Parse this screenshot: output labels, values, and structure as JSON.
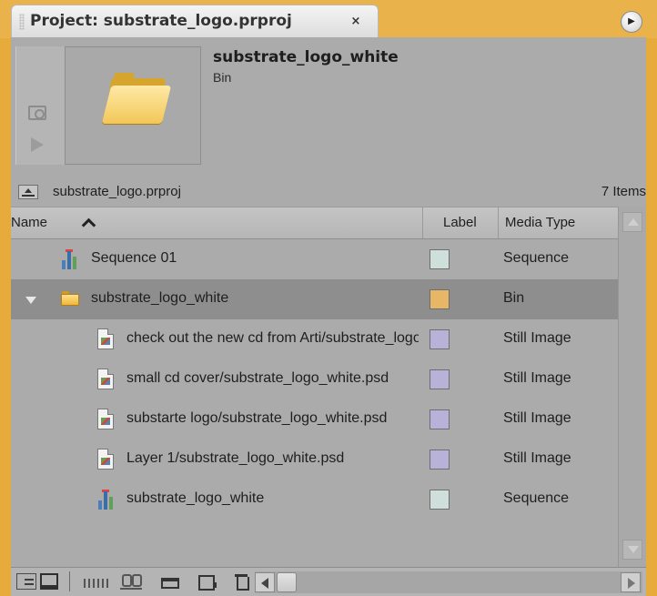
{
  "tab": {
    "title": "Project: substrate_logo.prproj",
    "close_glyph": "×"
  },
  "preview": {
    "clip_name": "substrate_logo_white",
    "clip_type": "Bin"
  },
  "path_bar": {
    "path": "substrate_logo.prproj",
    "item_count": "7 Items"
  },
  "columns": {
    "name": "Name",
    "label": "Label",
    "media_type": "Media Type"
  },
  "rows": [
    {
      "name": "Sequence 01",
      "label_color": "#cfdfdc",
      "media_type": "Sequence",
      "icon": "sequence-icon"
    },
    {
      "name": "substrate_logo_white",
      "label_color": "#e8b667",
      "media_type": "Bin",
      "icon": "folder-icon"
    },
    {
      "name": "check out the new cd from Arti/substrate_logo_white.psd",
      "label_color": "#b9b2d8",
      "media_type": "Still Image",
      "icon": "still-image-icon"
    },
    {
      "name": "small cd cover/substrate_logo_white.psd",
      "label_color": "#b9b2d8",
      "media_type": "Still Image",
      "icon": "still-image-icon"
    },
    {
      "name": "substarte logo/substrate_logo_white.psd",
      "label_color": "#b9b2d8",
      "media_type": "Still Image",
      "icon": "still-image-icon"
    },
    {
      "name": "Layer 1/substrate_logo_white.psd",
      "label_color": "#b9b2d8",
      "media_type": "Still Image",
      "icon": "still-image-icon"
    },
    {
      "name": "substrate_logo_white",
      "label_color": "#cfdfdc",
      "media_type": "Sequence",
      "icon": "sequence-icon"
    }
  ],
  "colors": {
    "panel_accent": "#e7ab3c",
    "panel_bg": "#ababab",
    "selected_row": "#8e8e8e"
  }
}
